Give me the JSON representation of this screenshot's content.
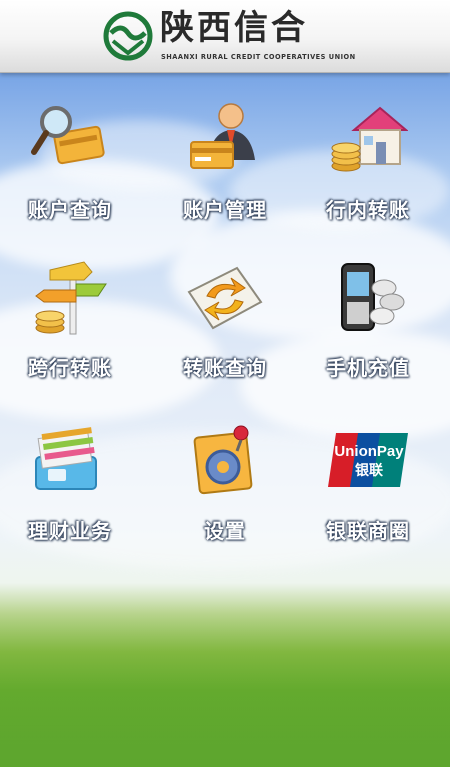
{
  "header": {
    "brand_title": "陕西信合",
    "brand_subtitle": "SHAANXI RURAL CREDIT COOPERATIVES UNION"
  },
  "menu": [
    {
      "label": "账户查询",
      "icon": "card-magnifier-icon"
    },
    {
      "label": "账户管理",
      "icon": "manager-with-card-icon"
    },
    {
      "label": "行内转账",
      "icon": "house-coins-icon"
    },
    {
      "label": "跨行转账",
      "icon": "signpost-coins-icon"
    },
    {
      "label": "转账查询",
      "icon": "transfer-arrows-icon"
    },
    {
      "label": "手机充值",
      "icon": "mobile-phone-coins-icon"
    },
    {
      "label": "理财业务",
      "icon": "finance-files-icon"
    },
    {
      "label": "设置",
      "icon": "gear-settings-icon"
    },
    {
      "label": "银联商圈",
      "icon": "unionpay-logo-icon"
    }
  ],
  "unionpay": {
    "top": "UnionPay",
    "bottom": "银联"
  },
  "colors": {
    "logo_green": "#1f7a3a",
    "label_text": "#ffffff",
    "unionpay_red": "#d71e28",
    "unionpay_blue": "#0b4fa0",
    "unionpay_teal": "#00807a"
  }
}
